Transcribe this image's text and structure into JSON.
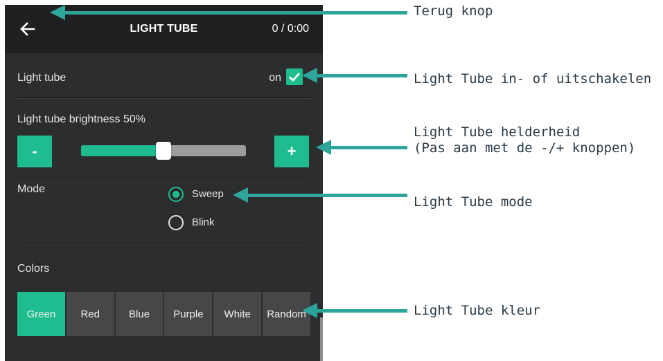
{
  "app": {
    "title": "LIGHT TUBE",
    "timer": "0 / 0:00"
  },
  "toggle": {
    "label": "Light tube",
    "state_text": "on",
    "checked": true
  },
  "brightness": {
    "label": "Light tube brightness 50%",
    "value_percent": 50,
    "minus_label": "-",
    "plus_label": "+"
  },
  "mode": {
    "label": "Mode",
    "options": [
      {
        "label": "Sweep",
        "selected": true
      },
      {
        "label": "Blink",
        "selected": false
      }
    ]
  },
  "colors": {
    "label": "Colors",
    "options": [
      {
        "label": "Green",
        "active": true
      },
      {
        "label": "Red",
        "active": false
      },
      {
        "label": "Blue",
        "active": false
      },
      {
        "label": "Purple",
        "active": false
      },
      {
        "label": "White",
        "active": false
      },
      {
        "label": "Random",
        "active": false
      }
    ]
  },
  "annotations": {
    "back": "Terug knop",
    "toggle": "Light Tube in- of uitschakelen",
    "brightness_line1": "Light Tube helderheid",
    "brightness_line2": "(Pas aan met de -/+ knoppen)",
    "mode": "Light Tube mode",
    "color": "Light Tube kleur"
  },
  "theme": {
    "accent": "#1ebc8f",
    "annotation_color": "#2ea59a",
    "panel_bg": "#2b2d2f"
  },
  "icons": {
    "back": "arrow-left-icon",
    "check": "check-icon"
  }
}
